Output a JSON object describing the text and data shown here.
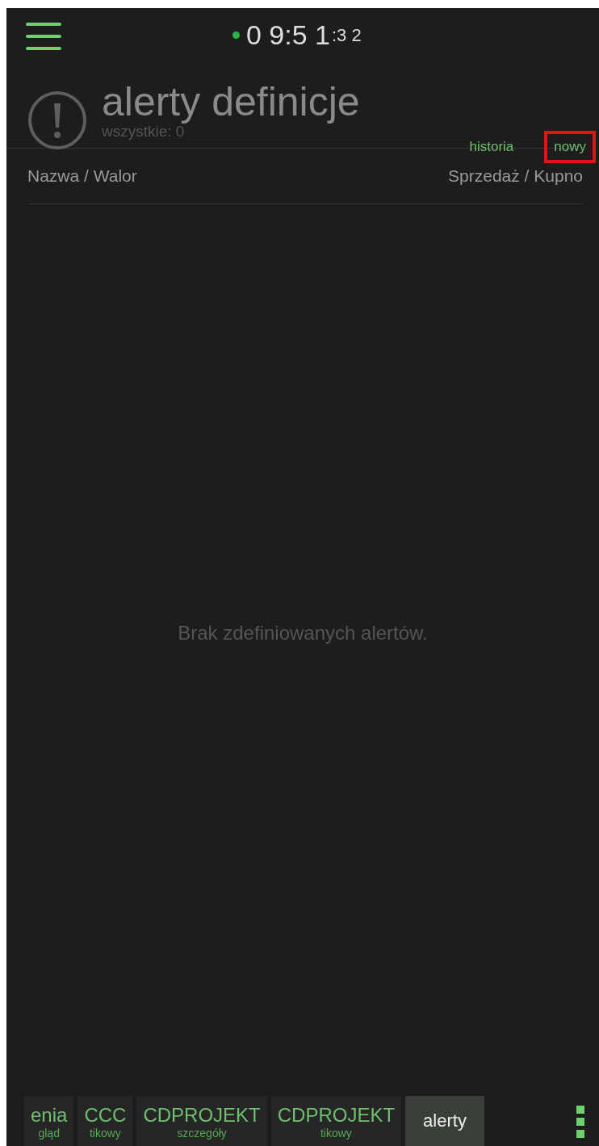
{
  "status": {
    "connected": true,
    "time_main": "0 9:5 1",
    "time_seconds": ":3 2"
  },
  "header": {
    "title": "alerty definicje",
    "count": "wszystkie: 0"
  },
  "actions": [
    {
      "label": "historia",
      "highlighted": false
    },
    {
      "label": "nowy",
      "highlighted": true
    }
  ],
  "table": {
    "columns": [
      "Nazwa / Walor",
      "Sprzedaż / Kupno"
    ],
    "empty_message": "Brak zdefiniowanych alertów."
  },
  "tabs": [
    {
      "title": "enia",
      "subtitle": "gląd",
      "selected": false
    },
    {
      "title": "CCC",
      "subtitle": "tikowy",
      "selected": false
    },
    {
      "title": "CDPROJEKT",
      "subtitle": "szczegóły",
      "selected": false
    },
    {
      "title": "CDPROJEKT",
      "subtitle": "tikowy",
      "selected": false
    },
    {
      "title": "alerty",
      "selected": true
    }
  ]
}
